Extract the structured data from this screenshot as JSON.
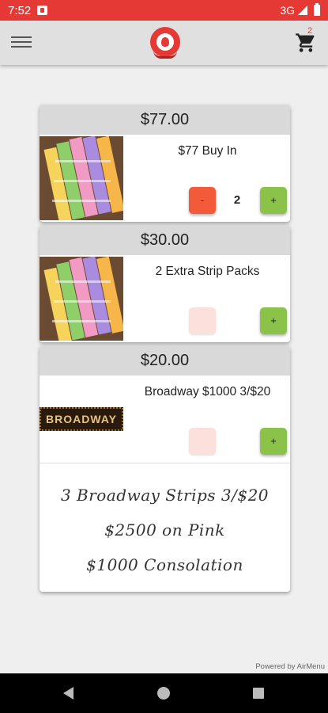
{
  "status_bar": {
    "time": "7:52",
    "network": "3G"
  },
  "app_bar": {
    "menu_icon": "hamburger-menu-icon",
    "logo_icon": "restaurant-logo-icon",
    "cart_icon": "shopping-cart-icon",
    "cart_count": "2"
  },
  "items": [
    {
      "price": "$77.00",
      "title": "$77 Buy In",
      "image": "pull-tab-tickets-photo",
      "minus_label": "-",
      "quantity": "2",
      "plus_label": "+"
    },
    {
      "price": "$30.00",
      "title": "2 Extra Strip Packs",
      "image": "pull-tab-tickets-photo",
      "minus_label": "",
      "quantity": "",
      "plus_label": "+"
    },
    {
      "price": "$20.00",
      "title": "Broadway $1000 3/$20",
      "image": "broadway-banner",
      "banner_text": "BROADWAY",
      "minus_label": "",
      "quantity": "",
      "plus_label": "+",
      "description": [
        "3 Broadway Strips  3/$20",
        "$2500 on Pink",
        "$1000 Consolation"
      ]
    }
  ],
  "footer": {
    "powered_by": "Powered by AirMenu"
  },
  "nav_bar": {
    "back_icon": "back-triangle-icon",
    "home_icon": "home-circle-icon",
    "recents_icon": "recents-square-icon"
  },
  "colors": {
    "status_bar": "#e53935",
    "minus_button": "#f25a3a",
    "plus_button": "#8bc34a",
    "price_header": "#d9d9d9"
  }
}
